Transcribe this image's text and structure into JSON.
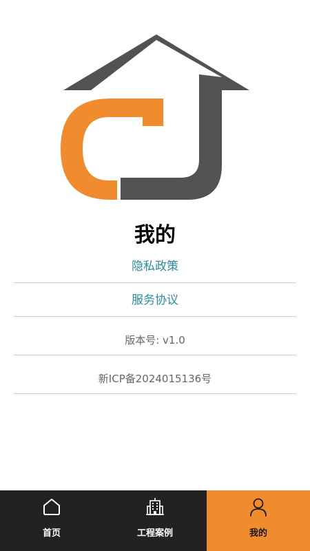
{
  "colors": {
    "accent": "#f08c2e",
    "logo_dark": "#525252",
    "link": "#2a8ca0",
    "tabbar_bg": "#222222",
    "divider": "#cfcfcf"
  },
  "logo": {
    "icon": "house-logo-icon"
  },
  "page": {
    "title": "我的"
  },
  "links": {
    "privacy": "隐私政策",
    "service": "服务协议"
  },
  "info": {
    "version": "版本号: v1.0",
    "icp": "新ICP备2024015136号"
  },
  "tabbar": {
    "items": [
      {
        "label": "首页",
        "icon": "home-icon",
        "active": false
      },
      {
        "label": "工程案例",
        "icon": "building-icon",
        "active": false
      },
      {
        "label": "我的",
        "icon": "user-icon",
        "active": true
      }
    ]
  }
}
